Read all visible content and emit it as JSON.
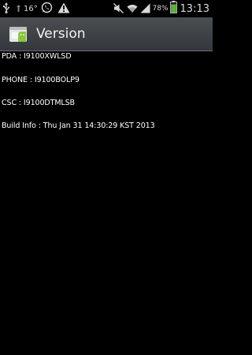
{
  "status_bar": {
    "temperature": "16°",
    "battery_percent": "78%",
    "time": "13:13",
    "icons": [
      "usb-icon",
      "weather-icon",
      "whatsapp-icon",
      "warning-icon",
      "mute-icon",
      "wifi-icon",
      "signal-icon",
      "battery-icon"
    ]
  },
  "title_bar": {
    "title": "Version",
    "icon": "android-app-icon"
  },
  "info": {
    "pda": "PDA : I9100XWLSD",
    "phone": "PHONE : I9100BOLP9",
    "csc": "CSC : I9100DTMLSB",
    "build_info": "Build Info : Thu Jan 31 14:30:29 KST 2013"
  },
  "colors": {
    "background": "#000000",
    "title_bar": "#3f4247",
    "battery_fill": "#5cb531",
    "text": "#ffffff"
  }
}
